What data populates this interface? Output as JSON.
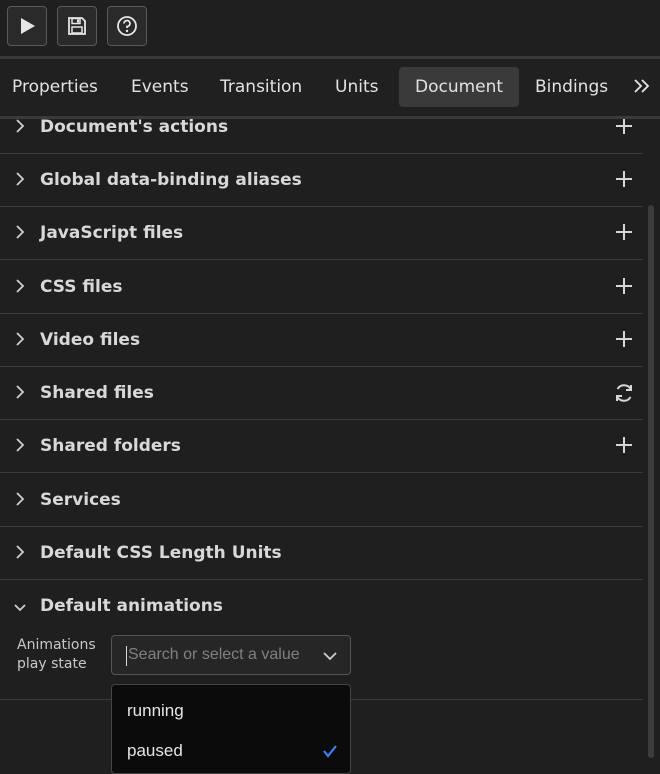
{
  "toolbar": {
    "buttons": [
      {
        "icon": "play-icon"
      },
      {
        "icon": "save-icon"
      },
      {
        "icon": "help-icon"
      }
    ]
  },
  "tabs": {
    "items": [
      {
        "label": "Properties"
      },
      {
        "label": "Events"
      },
      {
        "label": "Transition"
      },
      {
        "label": "Units"
      },
      {
        "label": "Document",
        "active": true
      },
      {
        "label": "Bindings"
      }
    ],
    "more_icon": "double-chevron-right-icon"
  },
  "sections": [
    {
      "label": "Document's actions",
      "action": "plus-icon"
    },
    {
      "label": "Global data-binding aliases",
      "action": "plus-icon"
    },
    {
      "label": "JavaScript files",
      "action": "plus-icon"
    },
    {
      "label": "CSS files",
      "action": "plus-icon"
    },
    {
      "label": "Video files",
      "action": "plus-icon"
    },
    {
      "label": "Shared files",
      "action": "refresh-icon"
    },
    {
      "label": "Shared folders",
      "action": "plus-icon"
    },
    {
      "label": "Services",
      "action": ""
    },
    {
      "label": "Default CSS Length Units",
      "action": ""
    },
    {
      "label": "Default animations",
      "action": "",
      "expanded": true
    }
  ],
  "animations": {
    "field_label": "Animations play state",
    "select": {
      "placeholder": "Search or select a value"
    },
    "options": [
      {
        "label": "running",
        "selected": false
      },
      {
        "label": "paused",
        "selected": true
      }
    ]
  },
  "colors": {
    "accent_check": "#3b82f6"
  }
}
